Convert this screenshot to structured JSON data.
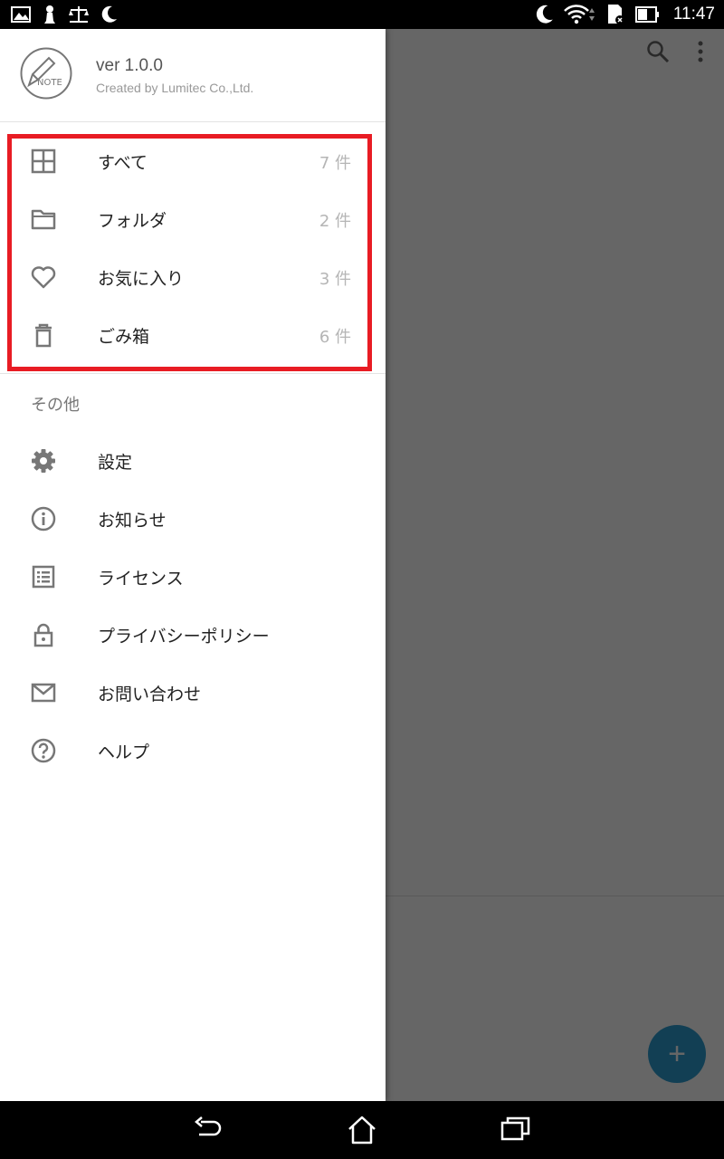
{
  "status_bar": {
    "time": "11:47",
    "left_icons": [
      "gallery-icon",
      "chess-pawn-icon",
      "scales-icon",
      "moon-icon"
    ],
    "right_icons": [
      "moon-icon",
      "wifi-icon",
      "sd-card-icon",
      "battery-icon"
    ]
  },
  "drawer": {
    "version": "ver 1.0.0",
    "created_by": "Created by Lumitec Co.,Ltd.",
    "logo_text": "NOTE",
    "items": [
      {
        "icon": "grid-icon",
        "label": "すべて",
        "count": "7 件"
      },
      {
        "icon": "folder-icon",
        "label": "フォルダ",
        "count": "2 件"
      },
      {
        "icon": "heart-icon",
        "label": "お気に入り",
        "count": "3 件"
      },
      {
        "icon": "trash-icon",
        "label": "ごみ箱",
        "count": "6 件"
      }
    ],
    "other_section_title": "その他",
    "other_items": [
      {
        "icon": "gear-icon",
        "label": "設定"
      },
      {
        "icon": "info-icon",
        "label": "お知らせ"
      },
      {
        "icon": "list-icon",
        "label": "ライセンス"
      },
      {
        "icon": "lock-icon",
        "label": "プライバシーポリシー"
      },
      {
        "icon": "mail-icon",
        "label": "お問い合わせ"
      },
      {
        "icon": "help-icon",
        "label": "ヘルプ"
      }
    ]
  },
  "fab": {
    "label": "+"
  },
  "colors": {
    "highlight": "#e81c24",
    "fab": "#2f9fd3"
  }
}
